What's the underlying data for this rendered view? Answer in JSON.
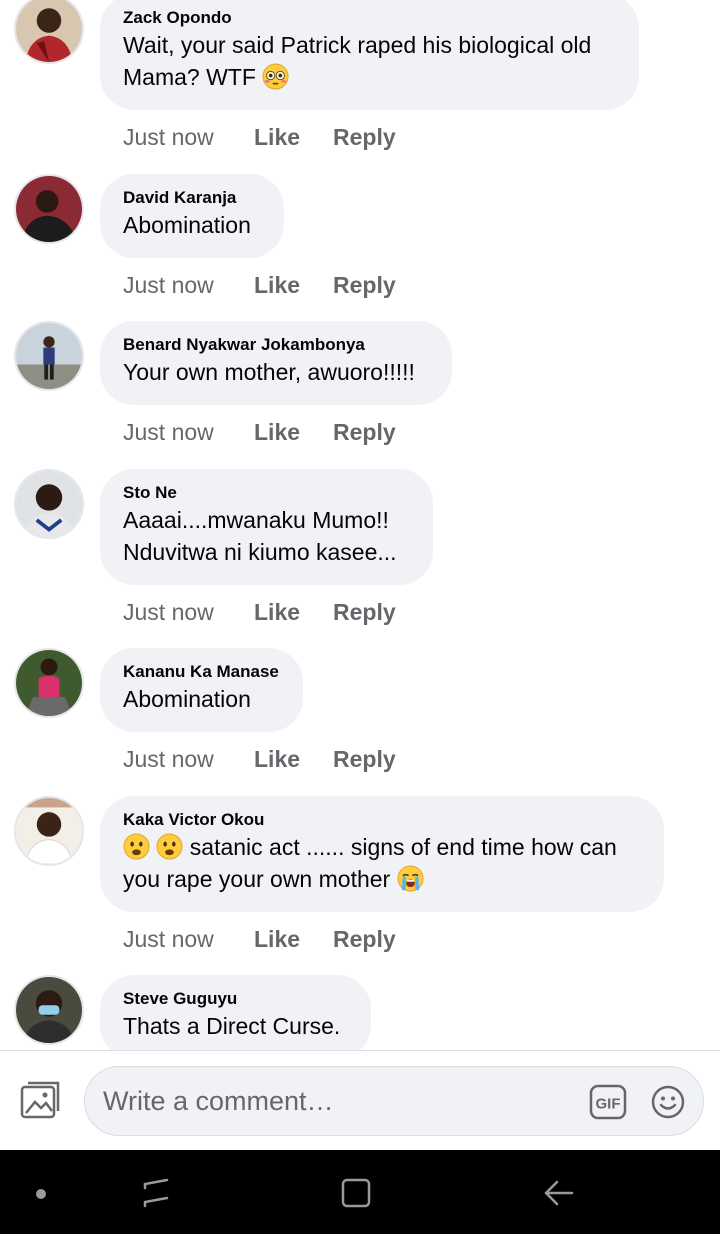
{
  "comments": [
    {
      "author": "Zack Opondo",
      "text": "Wait, your said Patrick raped his biological old Mama? WTF",
      "emoji_after": "flushed-face-emoji",
      "time": "Just now",
      "like": "Like",
      "reply": "Reply"
    },
    {
      "author": "David Karanja",
      "text": "Abomination",
      "time": "Just now",
      "like": "Like",
      "reply": "Reply"
    },
    {
      "author": "Benard Nyakwar Jokambonya",
      "text": "Your own mother, awuoro!!!!!",
      "time": "Just now",
      "like": "Like",
      "reply": "Reply"
    },
    {
      "author": "Sto Ne",
      "line1": "Aaaai....mwanaku Mumo!!",
      "line2": "Nduvitwa ni kiumo kasee...",
      "time": "Just now",
      "like": "Like",
      "reply": "Reply"
    },
    {
      "author": "Kananu Ka Manase",
      "text": "Abomination",
      "time": "Just now",
      "like": "Like",
      "reply": "Reply"
    },
    {
      "author": "Kaka Victor Okou",
      "emoji_before": [
        "frowning-face-emoji",
        "frowning-face-emoji"
      ],
      "text_part1": "satanic act ...... signs of end time how can",
      "text_part2": "you rape your own mother",
      "emoji_after": "loudly-crying-face-emoji",
      "time": "Just now",
      "like": "Like",
      "reply": "Reply"
    },
    {
      "author": "Steve Guguyu",
      "text": "Thats a Direct Curse."
    }
  ],
  "composer": {
    "placeholder": "Write a comment…",
    "photo_icon": "photo-icon",
    "gif_label": "GIF",
    "emoji_icon": "smiley-icon"
  },
  "navigation_bar": {
    "icons": [
      "dot-icon",
      "recents-icon",
      "home-icon",
      "back-icon"
    ]
  },
  "colors": {
    "bubble": "#f0f2f5",
    "meta_text": "#65676b",
    "nav_background": "#000000"
  }
}
